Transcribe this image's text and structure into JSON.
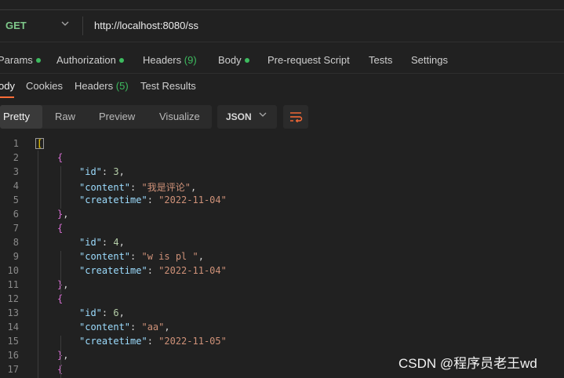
{
  "request": {
    "method": "GET",
    "url": "http://localhost:8080/ss"
  },
  "request_tabs": [
    {
      "label": "Params",
      "dot": true
    },
    {
      "label": "Authorization",
      "dot": true
    },
    {
      "label": "Headers",
      "count": "(9)"
    },
    {
      "label": "Body",
      "dot": true
    },
    {
      "label": "Pre-request Script"
    },
    {
      "label": "Tests"
    },
    {
      "label": "Settings"
    }
  ],
  "response_tabs": [
    {
      "label": "ody",
      "active": true
    },
    {
      "label": "Cookies"
    },
    {
      "label": "Headers",
      "count": "(5)"
    },
    {
      "label": "Test Results"
    }
  ],
  "format_buttons": [
    "Pretty",
    "Raw",
    "Preview",
    "Visualize"
  ],
  "format_selected": "Pretty",
  "language": "JSON",
  "code_lines": [
    {
      "n": "1",
      "t": "["
    },
    {
      "n": "2",
      "t": "{"
    },
    {
      "n": "3",
      "key": "\"id\"",
      "num": "3"
    },
    {
      "n": "4",
      "key": "\"content\"",
      "str": "\"我是评论\""
    },
    {
      "n": "5",
      "key": "\"createtime\"",
      "str": "\"2022-11-04\"",
      "last": true
    },
    {
      "n": "6",
      "t": "},"
    },
    {
      "n": "7",
      "t": "{"
    },
    {
      "n": "8",
      "key": "\"id\"",
      "num": "4"
    },
    {
      "n": "9",
      "key": "\"content\"",
      "str": "\"w is pl \""
    },
    {
      "n": "10",
      "key": "\"createtime\"",
      "str": "\"2022-11-04\"",
      "last": true
    },
    {
      "n": "11",
      "t": "},"
    },
    {
      "n": "12",
      "t": "{"
    },
    {
      "n": "13",
      "key": "\"id\"",
      "num": "6"
    },
    {
      "n": "14",
      "key": "\"content\"",
      "str": "\"aa\""
    },
    {
      "n": "15",
      "key": "\"createtime\"",
      "str": "\"2022-11-05\"",
      "last": true
    },
    {
      "n": "16",
      "t": "},"
    },
    {
      "n": "17",
      "t": "{"
    }
  ],
  "watermark": "CSDN @程序员老王wd",
  "colors": {
    "accent": "#ff6c37",
    "method": "#7ec88a",
    "dot": "#3dbb5f"
  }
}
